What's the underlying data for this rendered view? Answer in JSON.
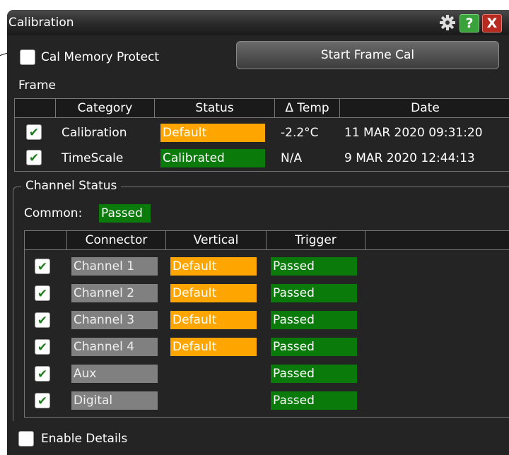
{
  "window": {
    "title": "Calibration"
  },
  "cal_memory_protect": {
    "label": "Cal Memory Protect",
    "checked": false
  },
  "start_frame_cal": {
    "label": "Start Frame Cal"
  },
  "frame": {
    "label": "Frame",
    "columns": [
      "Category",
      "Status",
      "Δ Temp",
      "Date"
    ],
    "rows": [
      {
        "checked": true,
        "category": "Calibration",
        "status": "Default",
        "status_color": "#ffa500",
        "delta_temp": "-2.2°C",
        "date": "11 MAR 2020 09:31:20"
      },
      {
        "checked": true,
        "category": "TimeScale",
        "status": "Calibrated",
        "status_color": "#0a7a0a",
        "delta_temp": "N/A",
        "date": "9 MAR 2020 12:44:13"
      }
    ]
  },
  "channel_status": {
    "label": "Channel Status",
    "common_label": "Common:",
    "common_value": "Passed",
    "columns": [
      "Connector",
      "Vertical",
      "Trigger"
    ],
    "rows": [
      {
        "checked": true,
        "connector": "Channel 1",
        "vertical": "Default",
        "trigger": "Passed"
      },
      {
        "checked": true,
        "connector": "Channel 2",
        "vertical": "Default",
        "trigger": "Passed"
      },
      {
        "checked": true,
        "connector": "Channel 3",
        "vertical": "Default",
        "trigger": "Passed"
      },
      {
        "checked": true,
        "connector": "Channel 4",
        "vertical": "Default",
        "trigger": "Passed"
      },
      {
        "checked": true,
        "connector": "Aux",
        "vertical": "",
        "trigger": "Passed"
      },
      {
        "checked": true,
        "connector": "Digital",
        "vertical": "",
        "trigger": "Passed"
      }
    ]
  },
  "enable_details": {
    "label": "Enable Details",
    "checked": false
  },
  "colors": {
    "default": "#ffa500",
    "passed": "#0a7a0a",
    "connector": "#808080"
  },
  "icons": {
    "settings": "gear-icon",
    "help": "help-icon",
    "close": "close-icon",
    "check": "check-icon"
  }
}
